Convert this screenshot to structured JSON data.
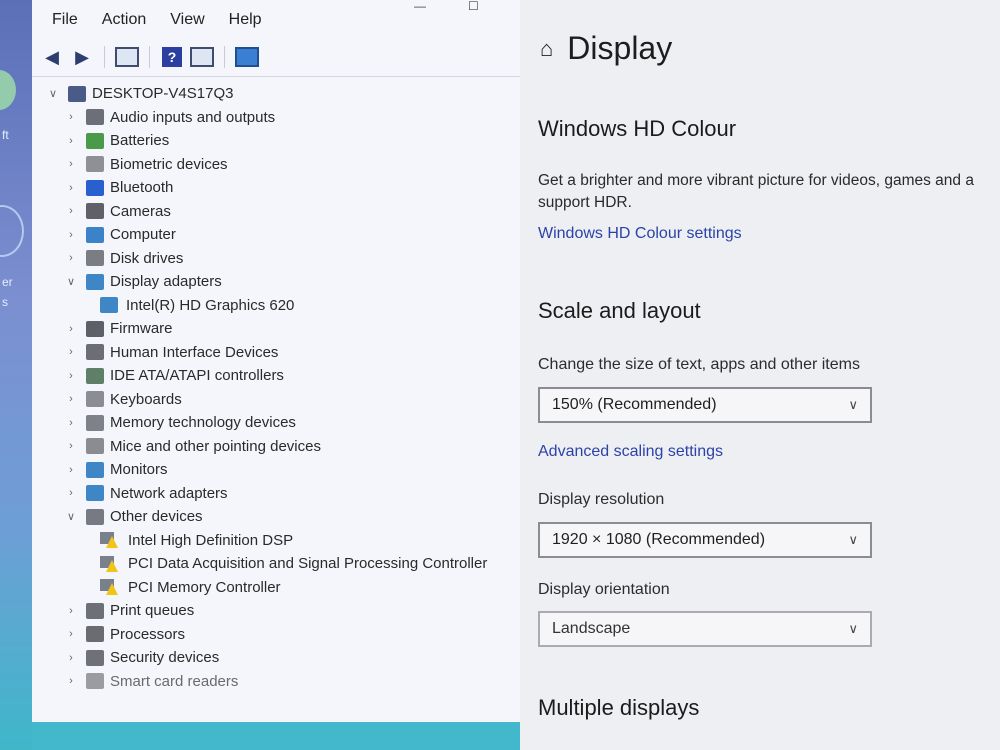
{
  "menu": [
    "File",
    "Action",
    "View",
    "Help"
  ],
  "tree": {
    "root": "DESKTOP-V4S17Q3",
    "items": [
      {
        "label": "Audio inputs and outputs",
        "expanded": false,
        "icon": "speaker-icon",
        "color": "#6d6f78"
      },
      {
        "label": "Batteries",
        "expanded": false,
        "icon": "battery-icon",
        "color": "#4a9a4a"
      },
      {
        "label": "Biometric devices",
        "expanded": false,
        "icon": "fingerprint-icon",
        "color": "#8f8f96"
      },
      {
        "label": "Bluetooth",
        "expanded": false,
        "icon": "bluetooth-icon",
        "color": "#2a5fcf"
      },
      {
        "label": "Cameras",
        "expanded": false,
        "icon": "camera-icon",
        "color": "#5f6068"
      },
      {
        "label": "Computer",
        "expanded": false,
        "icon": "computer-icon",
        "color": "#3b82c8"
      },
      {
        "label": "Disk drives",
        "expanded": false,
        "icon": "disk-icon",
        "color": "#7b7d84"
      },
      {
        "label": "Display adapters",
        "expanded": true,
        "icon": "display-adapter-icon",
        "color": "#3f86c6",
        "children": [
          {
            "label": "Intel(R) HD Graphics 620",
            "warning": false
          }
        ]
      },
      {
        "label": "Firmware",
        "expanded": false,
        "icon": "firmware-icon",
        "color": "#5e6068"
      },
      {
        "label": "Human Interface Devices",
        "expanded": false,
        "icon": "hid-icon",
        "color": "#6c6e76"
      },
      {
        "label": "IDE ATA/ATAPI controllers",
        "expanded": false,
        "icon": "ide-controller-icon",
        "color": "#5f7f68"
      },
      {
        "label": "Keyboards",
        "expanded": false,
        "icon": "keyboard-icon",
        "color": "#8b8d94"
      },
      {
        "label": "Memory technology devices",
        "expanded": false,
        "icon": "memory-icon",
        "color": "#7f8188"
      },
      {
        "label": "Mice and other pointing devices",
        "expanded": false,
        "icon": "mouse-icon",
        "color": "#8a8c92"
      },
      {
        "label": "Monitors",
        "expanded": false,
        "icon": "monitor-icon",
        "color": "#3f86c6"
      },
      {
        "label": "Network adapters",
        "expanded": false,
        "icon": "network-icon",
        "color": "#3f86c6"
      },
      {
        "label": "Other devices",
        "expanded": true,
        "icon": "other-devices-icon",
        "color": "#777a82",
        "children": [
          {
            "label": "Intel High Definition DSP",
            "warning": true
          },
          {
            "label": "PCI Data Acquisition and Signal Processing Controller",
            "warning": true
          },
          {
            "label": "PCI Memory Controller",
            "warning": true
          }
        ]
      },
      {
        "label": "Print queues",
        "expanded": false,
        "icon": "printer-icon",
        "color": "#6e7078"
      },
      {
        "label": "Processors",
        "expanded": false,
        "icon": "processor-icon",
        "color": "#6a6c72"
      },
      {
        "label": "Security devices",
        "expanded": false,
        "icon": "security-icon",
        "color": "#6f7179"
      },
      {
        "label": "Smart card readers",
        "expanded": false,
        "icon": "smartcard-icon",
        "color": "#9a9ca2",
        "faded": true
      }
    ]
  },
  "settings": {
    "title": "Display",
    "hdr": {
      "heading": "Windows HD Colour",
      "description": "Get a brighter and more vibrant picture for videos, games and a",
      "description2": "support HDR.",
      "link": "Windows HD Colour settings"
    },
    "scale": {
      "heading": "Scale and layout",
      "size_label": "Change the size of text, apps and other items",
      "size_value": "150% (Recommended)",
      "advanced_link": "Advanced scaling settings",
      "resolution_label": "Display resolution",
      "resolution_value": "1920 × 1080 (Recommended)",
      "orientation_label": "Display orientation",
      "orientation_value": "Landscape"
    },
    "multiple_heading": "Multiple displays"
  },
  "desktop_text": [
    "ft",
    "er",
    "s"
  ],
  "colors": {
    "link": "#2b43a8",
    "warning": "#f0c419",
    "accent": "#3f86c6"
  }
}
